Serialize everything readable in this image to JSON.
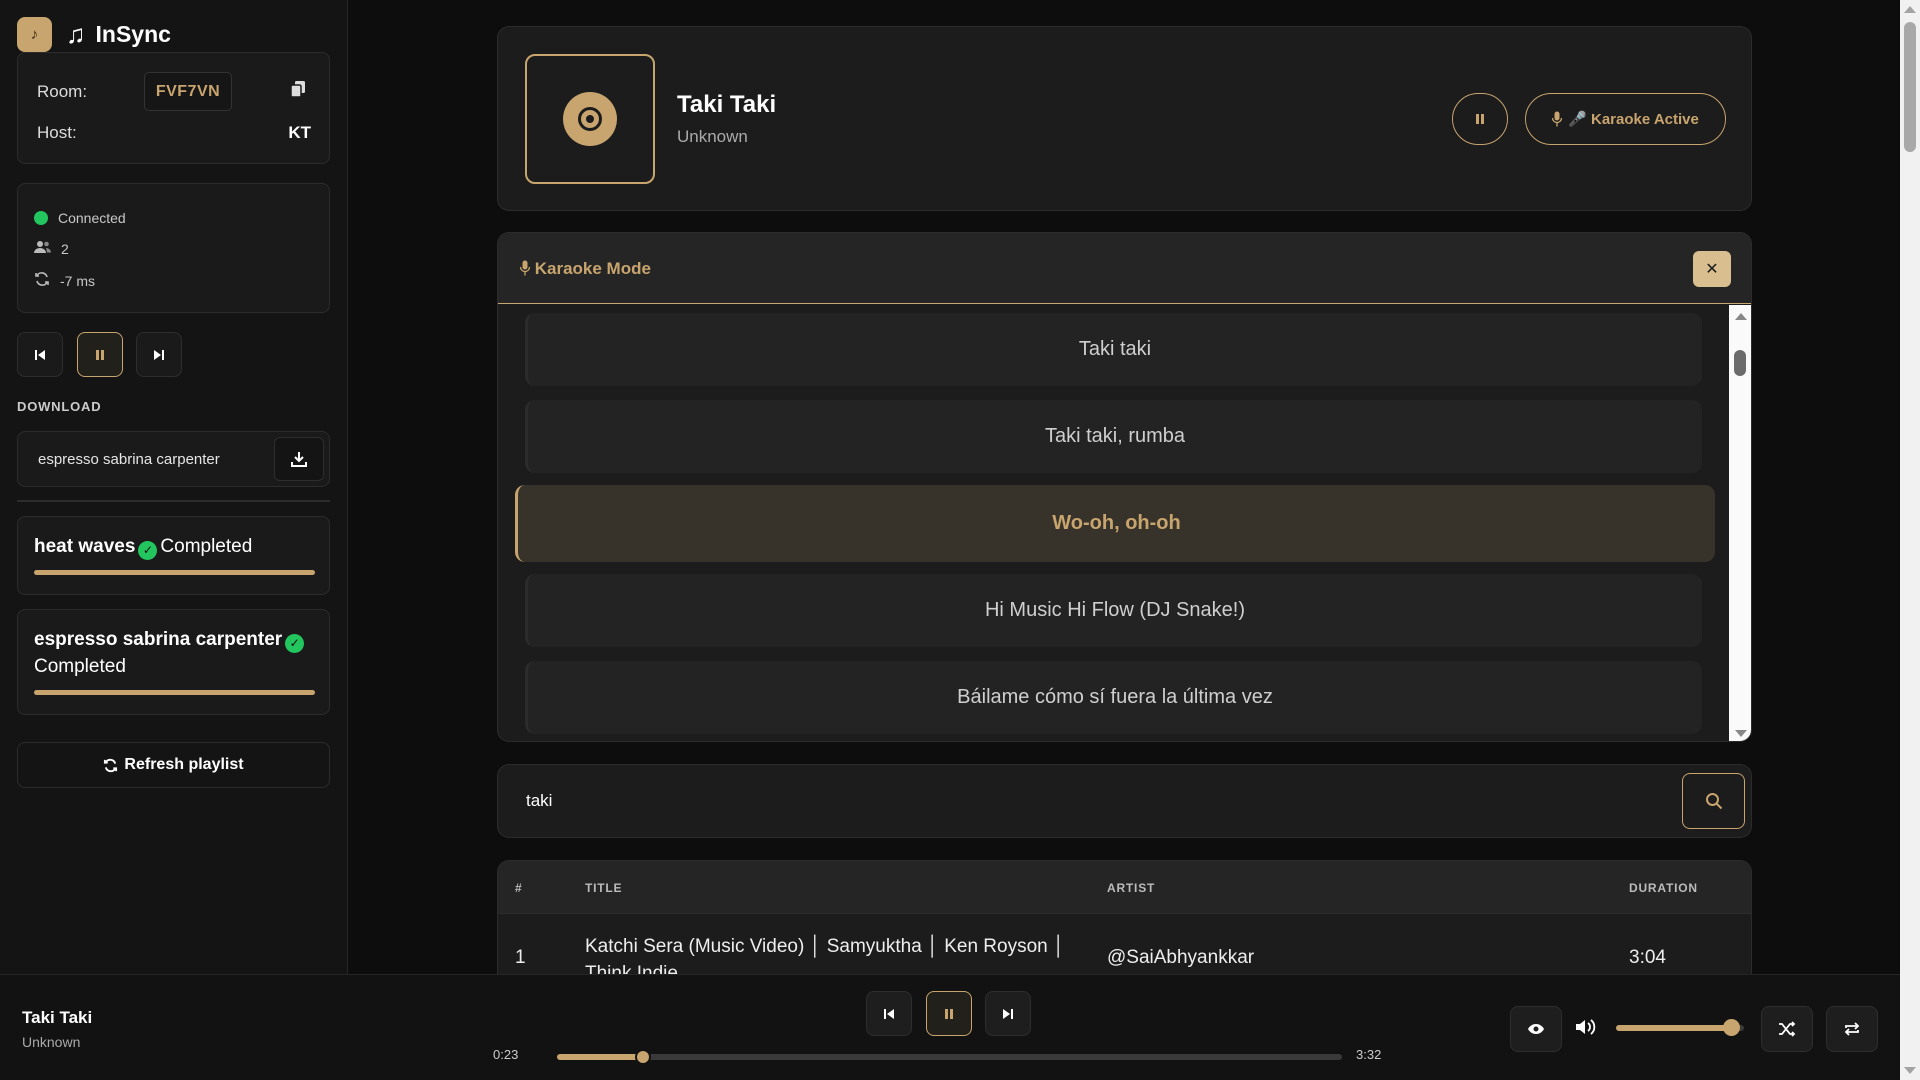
{
  "app": {
    "name": "InSync"
  },
  "room": {
    "label": "Room:",
    "code": "FVF7VN",
    "host_label": "Host:",
    "host": "KT"
  },
  "status": {
    "connection": "Connected",
    "listeners": "2",
    "latency": "-7 ms"
  },
  "download": {
    "heading": "DOWNLOAD",
    "input_value": "espresso sabrina carpenter",
    "items": [
      {
        "title": "heat waves",
        "status": "Completed",
        "progress": 1.0
      },
      {
        "title": "espresso sabrina carpenter",
        "status": "Completed",
        "progress": 1.0
      }
    ],
    "refresh_label": "Refresh playlist"
  },
  "now_playing": {
    "title": "Taki Taki",
    "artist": "Unknown",
    "karaoke_label": "🎤 Karaoke Active"
  },
  "karaoke": {
    "title": "Karaoke Mode",
    "lines": [
      "Taki taki",
      "Taki taki, rumba",
      "Wo-oh, oh-oh",
      "Hi Music Hi Flow (DJ Snake!)",
      "Báilame cómo sí fuera la última vez"
    ],
    "current_index": 2
  },
  "search": {
    "value": "taki"
  },
  "results": {
    "headers": {
      "num": "#",
      "title": "TITLE",
      "artist": "ARTIST",
      "duration": "DURATION"
    },
    "rows": [
      {
        "num": "1",
        "title": "Katchi Sera (Music Video) │ Samyuktha │ Ken Royson │ Think Indie",
        "artist": "@SaiAbhyankkar",
        "duration": "3:04"
      }
    ]
  },
  "player": {
    "title": "Taki Taki",
    "artist": "Unknown",
    "elapsed": "0:23",
    "total": "3:32",
    "progress": 0.11,
    "volume": 0.9
  },
  "colors": {
    "accent": "#c8a46e",
    "success": "#22c55e",
    "background": "#0d0d0d"
  }
}
